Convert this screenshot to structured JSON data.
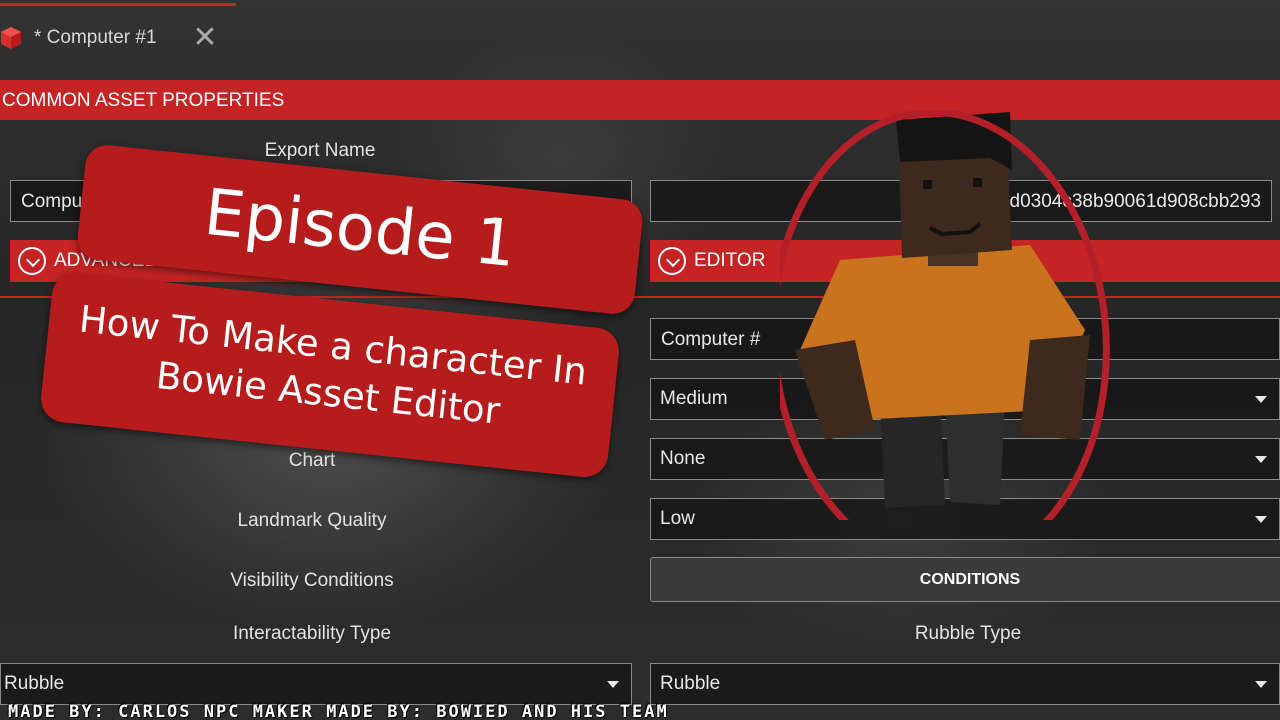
{
  "window": {
    "tab_title": "* Computer #1",
    "close_icon": "close-icon",
    "app_icon": "red-cube-icon"
  },
  "section_header": "COMMON ASSET PROPERTIES",
  "fields": {
    "export_name_label": "Export Name",
    "export_name_value": "Compu",
    "guid_value": "d0304c38b90061d908cbb293",
    "advanced_expander": "ADVANCED",
    "editor_expander": "EDITOR",
    "name_value": "Computer #",
    "size_value": "Medium",
    "chart_label": "Chart",
    "chart_value": "None",
    "landmark_quality_label": "Landmark Quality",
    "landmark_quality_value": "Low",
    "visibility_conditions_label": "Visibility Conditions",
    "conditions_button": "CONDITIONS",
    "interactability_type_label": "Interactability Type",
    "interactability_type_value": "Rubble",
    "rubble_type_label": "Rubble Type",
    "rubble_type_value": "Rubble"
  },
  "overlay": {
    "episode_title": "Episode 1",
    "subtitle_line1": "How To Make a character In",
    "subtitle_line2": "Bowie Asset Editor",
    "credits": "MADE BY: CARLOS  NPC MAKER MADE BY: BOWIED AND HIS TEAM"
  },
  "colors": {
    "accent_red": "#c62424",
    "banner_red": "#b71c1c",
    "circle_red": "#b3202a",
    "shirt_orange": "#c9731f",
    "skin_brown": "#3d2a1c"
  }
}
